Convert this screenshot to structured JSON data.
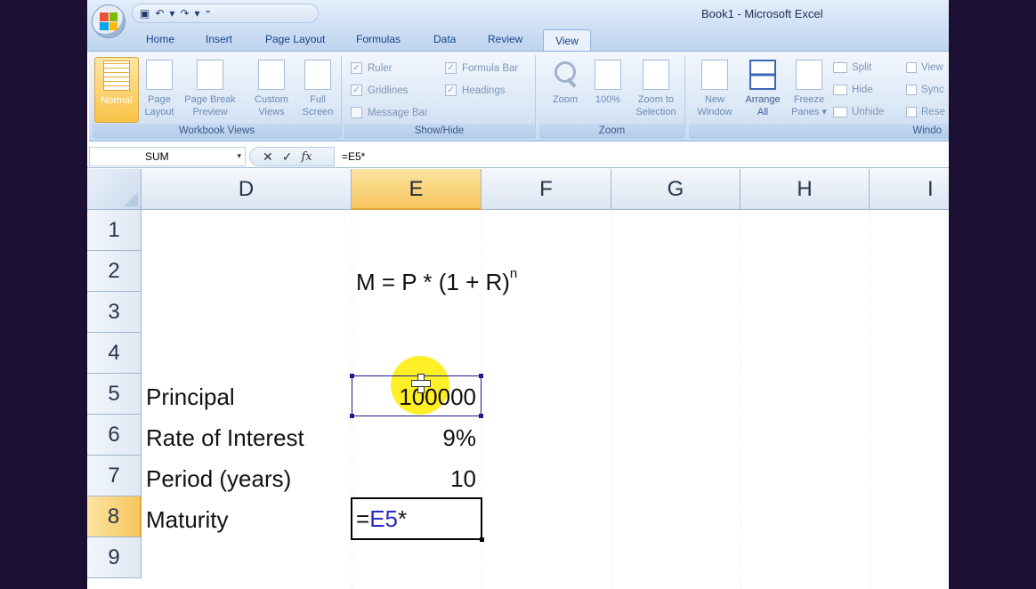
{
  "window": {
    "title": "Book1 - Microsoft Excel"
  },
  "qat": {
    "items": [
      "save-icon",
      "undo-icon",
      "redo-icon",
      "customize-icon"
    ],
    "undo_glyph": "↶",
    "redo_glyph": "↷",
    "save_glyph": "▣",
    "customize_glyph": "⁼",
    "dropdown_glyph": "▾"
  },
  "tabs": [
    "Home",
    "Insert",
    "Page Layout",
    "Formulas",
    "Data",
    "Review",
    "View"
  ],
  "ribbon": {
    "workbook_views": {
      "label": "Workbook Views",
      "normal": "Normal",
      "page_layout": [
        "Page",
        "Layout"
      ],
      "page_break": [
        "Page Break",
        "Preview"
      ],
      "custom_views": [
        "Custom",
        "Views"
      ],
      "full_screen": [
        "Full",
        "Screen"
      ]
    },
    "show_hide": {
      "label": "Show/Hide",
      "ruler": "Ruler",
      "gridlines": "Gridlines",
      "message_bar": "Message Bar",
      "formula_bar": "Formula Bar",
      "headings": "Headings",
      "check": "✓"
    },
    "zoom": {
      "label": "Zoom",
      "zoom": "Zoom",
      "hundred": "100%",
      "zoom_to": [
        "Zoom to",
        "Selection"
      ]
    },
    "window": {
      "label": "Windo",
      "new_window": [
        "New",
        "Window"
      ],
      "arrange_all": [
        "Arrange",
        "All"
      ],
      "freeze_panes": [
        "Freeze",
        "Panes ▾"
      ],
      "split": "Split",
      "hide": "Hide",
      "unhide": "Unhide",
      "view_side": "View",
      "sync": "Sync",
      "reset": "Rese"
    }
  },
  "formula_bar": {
    "name_box": "SUM",
    "name_box_caret": "▾",
    "cancel": "✕",
    "enter": "✓",
    "fx": "fx",
    "content": "=E5*"
  },
  "columns": [
    "D",
    "E",
    "F",
    "G",
    "H",
    "I"
  ],
  "rows": [
    "1",
    "2",
    "3",
    "4",
    "5",
    "6",
    "7",
    "8",
    "9"
  ],
  "selected": {
    "column": "E",
    "row": "8"
  },
  "cells": {
    "formula_base": "M = P * (1 + R)",
    "formula_exp": "n",
    "d5": "Principal",
    "d6": "Rate of Interest",
    "d7": "Period (years)",
    "d8": "Maturity",
    "e5": "100000",
    "e6": "9%",
    "e7": "10",
    "e8_eq": "=",
    "e8_ref": "E5",
    "e8_op": "*"
  },
  "colors": {
    "reference": "#2a2ac8",
    "selected_header": "#f7c65c",
    "cursor_highlight": "#ffec00"
  }
}
